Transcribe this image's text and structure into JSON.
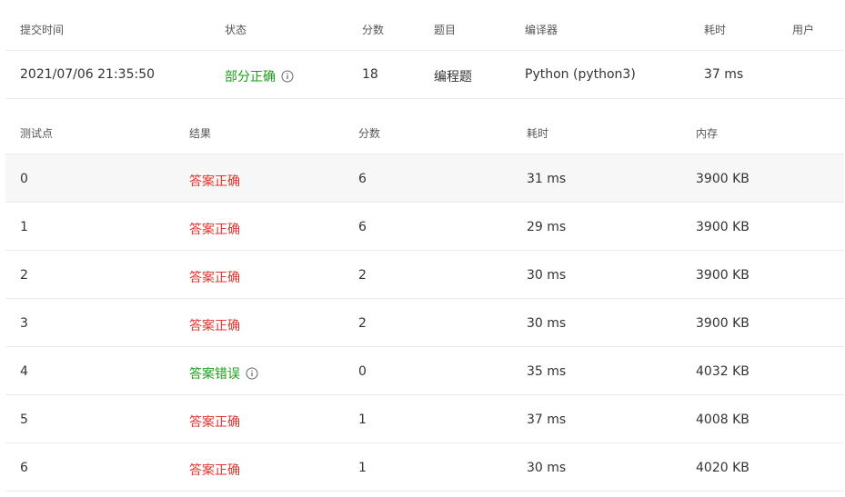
{
  "submission": {
    "headers": {
      "time": "提交时间",
      "status": "状态",
      "score": "分数",
      "problem": "题目",
      "compiler": "编译器",
      "elapsed": "耗时",
      "user": "用户"
    },
    "row": {
      "time": "2021/07/06 21:35:50",
      "status": "部分正确",
      "score": "18",
      "problem": "编程题",
      "compiler": "Python (python3)",
      "elapsed": "37 ms",
      "user": ""
    },
    "status_color": "#1a9e1a"
  },
  "testcases": {
    "headers": {
      "id": "测试点",
      "result": "结果",
      "score": "分数",
      "elapsed": "耗时",
      "memory": "内存"
    },
    "rows": [
      {
        "id": "0",
        "result": "答案正确",
        "score": "6",
        "elapsed": "31 ms",
        "memory": "3900 KB"
      },
      {
        "id": "1",
        "result": "答案正确",
        "score": "6",
        "elapsed": "29 ms",
        "memory": "3900 KB"
      },
      {
        "id": "2",
        "result": "答案正确",
        "score": "2",
        "elapsed": "30 ms",
        "memory": "3900 KB"
      },
      {
        "id": "3",
        "result": "答案正确",
        "score": "2",
        "elapsed": "30 ms",
        "memory": "3900 KB"
      },
      {
        "id": "4",
        "result": "答案错误",
        "score": "0",
        "elapsed": "35 ms",
        "memory": "4032 KB"
      },
      {
        "id": "5",
        "result": "答案正确",
        "score": "1",
        "elapsed": "37 ms",
        "memory": "4008 KB"
      },
      {
        "id": "6",
        "result": "答案正确",
        "score": "1",
        "elapsed": "30 ms",
        "memory": "4020 KB"
      }
    ],
    "colors": {
      "correct": "#e0342f",
      "wrong": "#1a9e1a"
    }
  },
  "icons": {
    "status_info": "info-icon",
    "result_info": "info-icon"
  }
}
